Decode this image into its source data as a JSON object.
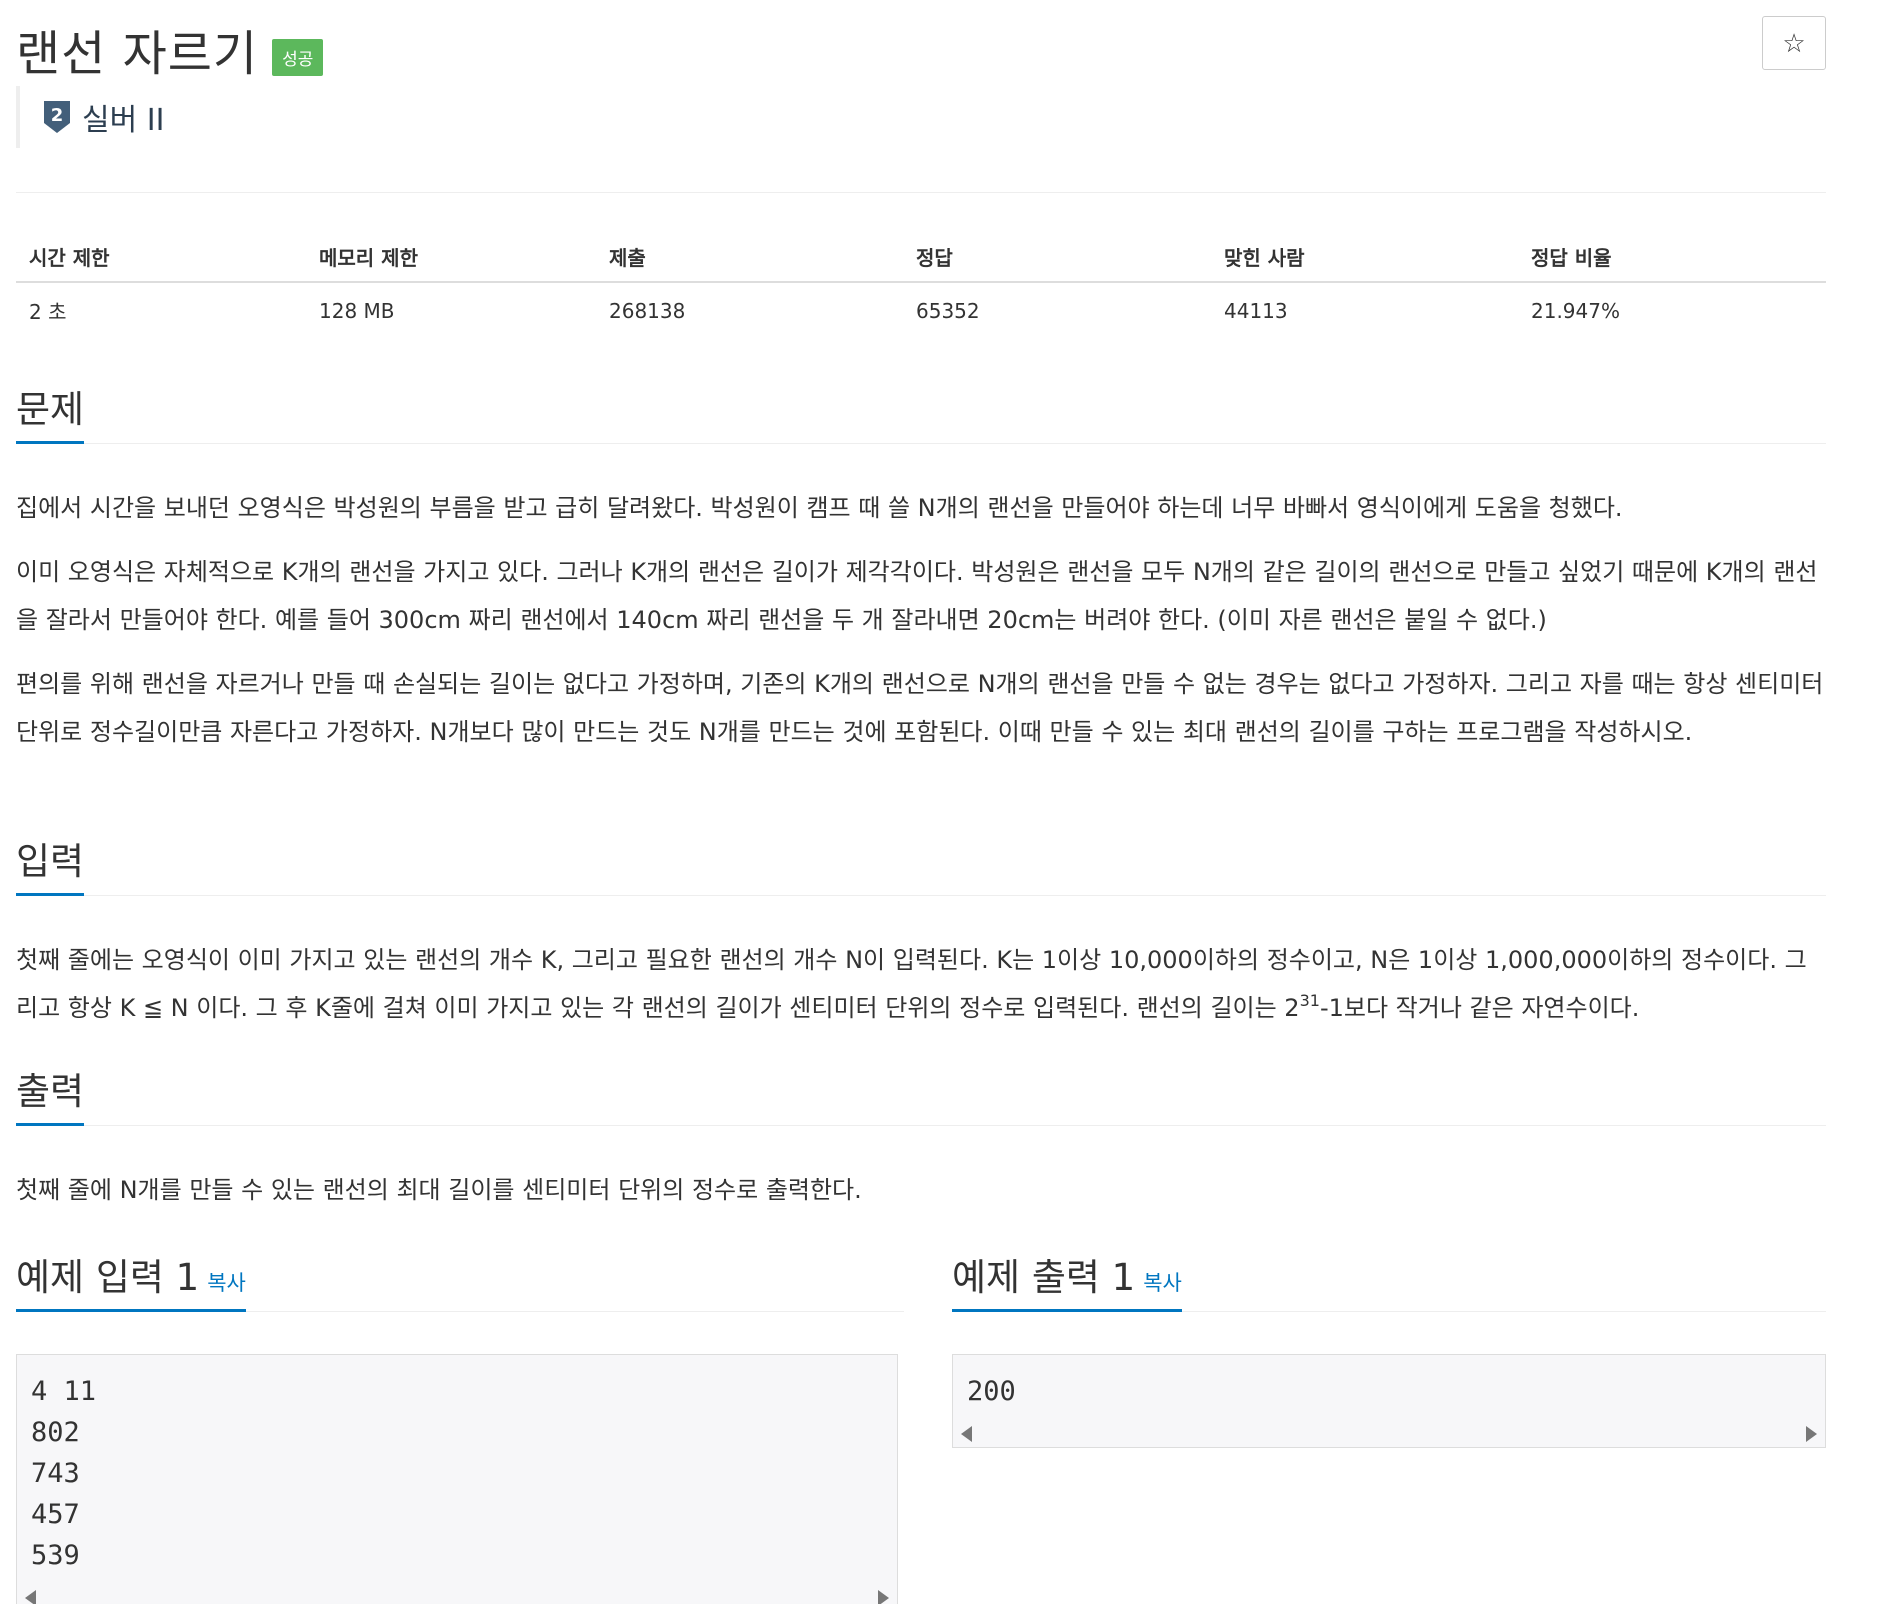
{
  "problem": {
    "title": "랜선 자르기",
    "status_badge": "성공",
    "star_icon": "☆",
    "tier_icon_number": "2",
    "tier_label": "실버 II",
    "tier_color": "#435f7a"
  },
  "stats": {
    "headers": [
      "시간 제한",
      "메모리 제한",
      "제출",
      "정답",
      "맞힌 사람",
      "정답 비율"
    ],
    "values": [
      "2 초",
      "128 MB",
      "268138",
      "65352",
      "44113",
      "21.947%"
    ]
  },
  "sections": {
    "description": {
      "title": "문제",
      "paragraphs": [
        "집에서 시간을 보내던 오영식은 박성원의 부름을 받고 급히 달려왔다. 박성원이 캠프 때 쓸 N개의 랜선을 만들어야 하는데 너무 바빠서 영식이에게 도움을 청했다.",
        "이미 오영식은 자체적으로 K개의 랜선을 가지고 있다. 그러나 K개의 랜선은 길이가 제각각이다. 박성원은 랜선을 모두 N개의 같은 길이의 랜선으로 만들고 싶었기 때문에 K개의 랜선을 잘라서 만들어야 한다. 예를 들어 300cm 짜리 랜선에서 140cm 짜리 랜선을 두 개 잘라내면 20cm는 버려야 한다. (이미 자른 랜선은 붙일 수 없다.)",
        "편의를 위해 랜선을 자르거나 만들 때 손실되는 길이는 없다고 가정하며, 기존의 K개의 랜선으로 N개의 랜선을 만들 수 없는 경우는 없다고 가정하자. 그리고 자를 때는 항상 센티미터 단위로 정수길이만큼 자른다고 가정하자. N개보다 많이 만드는 것도 N개를 만드는 것에 포함된다. 이때 만들 수 있는 최대 랜선의 길이를 구하는 프로그램을 작성하시오."
      ]
    },
    "input": {
      "title": "입력",
      "text_before_sup": "첫째 줄에는 오영식이 이미 가지고 있는 랜선의 개수 K, 그리고 필요한 랜선의 개수 N이 입력된다. K는 1이상 10,000이하의 정수이고, N은 1이상 1,000,000이하의 정수이다. 그리고 항상 K ≦ N 이다. 그 후 K줄에 걸쳐 이미 가지고 있는 각 랜선의 길이가 센티미터 단위의 정수로 입력된다. 랜선의 길이는 2",
      "sup": "31",
      "text_after_sup": "-1보다 작거나 같은 자연수이다."
    },
    "output": {
      "title": "출력",
      "text": "첫째 줄에 N개를 만들 수 있는 랜선의 최대 길이를 센티미터 단위의 정수로 출력한다."
    }
  },
  "samples": {
    "input": {
      "title": "예제 입력 1",
      "copy_label": "복사",
      "content": "4 11\n802\n743\n457\n539"
    },
    "output": {
      "title": "예제 출력 1",
      "copy_label": "복사",
      "content": "200"
    }
  }
}
